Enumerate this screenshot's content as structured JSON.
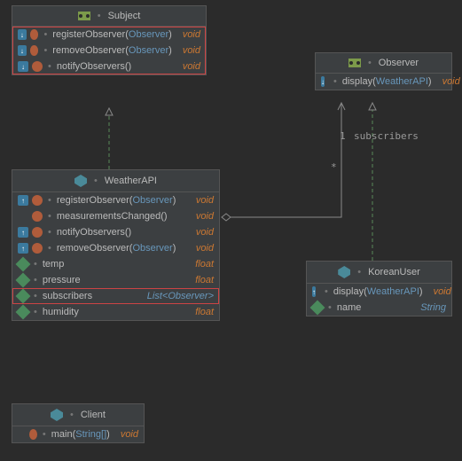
{
  "subject": {
    "name": "Subject",
    "methods": [
      {
        "name": "registerObserver",
        "params": "Observer",
        "ret": "void"
      },
      {
        "name": "removeObserver",
        "params": "Observer",
        "ret": "void"
      },
      {
        "name": "notifyObservers",
        "params": "",
        "ret": "void"
      }
    ]
  },
  "observer": {
    "name": "Observer",
    "methods": [
      {
        "name": "display",
        "params": "WeatherAPI",
        "ret": "void"
      }
    ]
  },
  "weatherapi": {
    "name": "WeatherAPI",
    "methods": [
      {
        "name": "registerObserver",
        "params": "Observer",
        "ret": "void",
        "override": true
      },
      {
        "name": "measurementsChanged",
        "params": "",
        "ret": "void",
        "override": false
      },
      {
        "name": "notifyObservers",
        "params": "",
        "ret": "void",
        "override": true
      },
      {
        "name": "removeObserver",
        "params": "Observer",
        "ret": "void",
        "override": true
      }
    ],
    "fields": [
      {
        "name": "temp",
        "type": "float"
      },
      {
        "name": "pressure",
        "type": "float"
      },
      {
        "name": "subscribers",
        "type": "List<Observer>",
        "hl": true
      },
      {
        "name": "humidity",
        "type": "float"
      }
    ]
  },
  "koreanuser": {
    "name": "KoreanUser",
    "methods": [
      {
        "name": "display",
        "params": "WeatherAPI",
        "ret": "void",
        "override": true
      }
    ],
    "fields": [
      {
        "name": "name",
        "type": "String"
      }
    ]
  },
  "client": {
    "name": "Client",
    "methods": [
      {
        "name": "main",
        "params": "String[]",
        "ret": "void"
      }
    ]
  },
  "edges": {
    "multFrom": "*",
    "multTo": "1",
    "role": "subscribers"
  }
}
